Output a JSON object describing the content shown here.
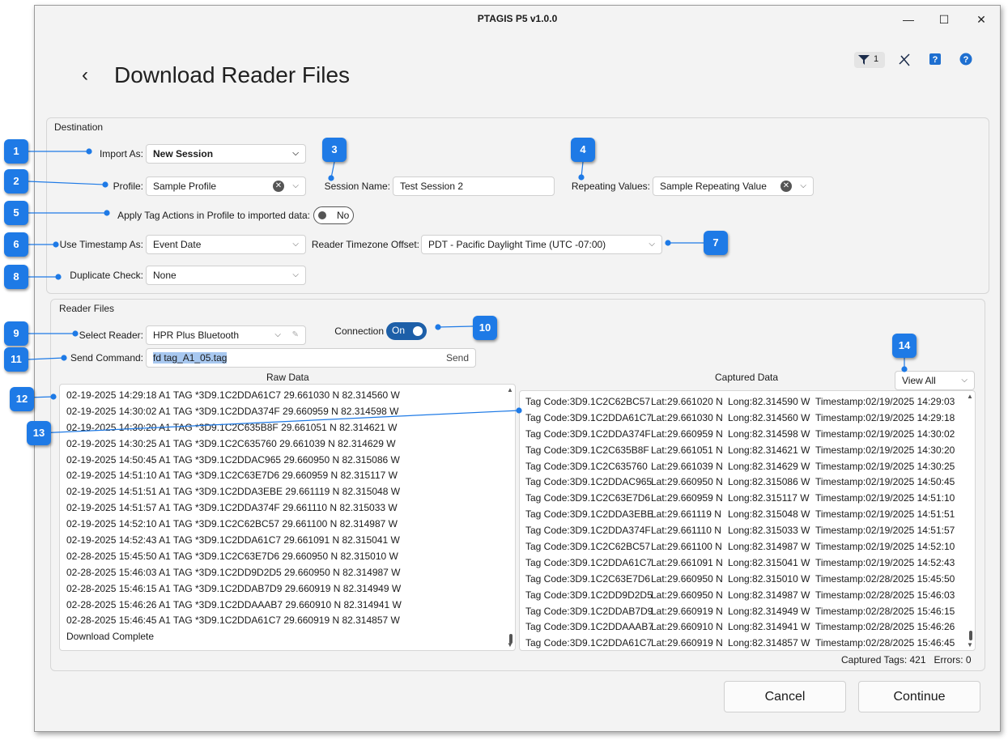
{
  "app_title": "PTAGIS P5 v1.0.0",
  "toolbar": {
    "filter_count": "1"
  },
  "page_title": "Download Reader Files",
  "destination": {
    "group_title": "Destination",
    "import_as_label": "Import As:",
    "import_as_value": "New Session",
    "profile_label": "Profile:",
    "profile_value": "Sample Profile",
    "session_name_label": "Session Name:",
    "session_name_value": "Test Session 2",
    "repeating_values_label": "Repeating Values:",
    "repeating_values_value": "Sample Repeating Value",
    "apply_tag_actions_label": "Apply Tag Actions in Profile to imported data:",
    "apply_tag_actions_value": "No",
    "timestamp_label": "Use Timestamp As:",
    "timestamp_value": "Event Date",
    "tz_label": "Reader Timezone Offset:",
    "tz_value": "PDT - Pacific Daylight Time (UTC -07:00)",
    "duplicate_label": "Duplicate Check:",
    "duplicate_value": "None"
  },
  "reader_files": {
    "group_title": "Reader Files",
    "select_reader_label": "Select Reader:",
    "select_reader_value": "HPR Plus Bluetooth",
    "connection_label": "Connection",
    "connection_value": "On",
    "send_command_label": "Send Command:",
    "send_command_value": "fd tag_A1_05.tag",
    "send_label": "Send",
    "raw_data_title": "Raw Data",
    "captured_data_title": "Captured Data",
    "view_value": "View All",
    "raw_data": [
      "02-19-2025 14:29:18 A1 TAG *3D9.1C2DDA61C7 29.661030 N 82.314560 W",
      "02-19-2025 14:30:02 A1 TAG *3D9.1C2DDA374F 29.660959 N 82.314598 W",
      "02-19-2025 14:30:20 A1 TAG *3D9.1C2C635B8F 29.661051 N 82.314621 W",
      "02-19-2025 14:30:25 A1 TAG *3D9.1C2C635760 29.661039 N 82.314629 W",
      "02-19-2025 14:50:45 A1 TAG *3D9.1C2DDAC965 29.660950 N 82.315086 W",
      "02-19-2025 14:51:10 A1 TAG *3D9.1C2C63E7D6 29.660959 N 82.315117 W",
      "02-19-2025 14:51:51 A1 TAG *3D9.1C2DDA3EBE 29.661119 N 82.315048 W",
      "02-19-2025 14:51:57 A1 TAG *3D9.1C2DDA374F 29.661110 N 82.315033 W",
      "02-19-2025 14:52:10 A1 TAG *3D9.1C2C62BC57 29.661100 N 82.314987 W",
      "02-19-2025 14:52:43 A1 TAG *3D9.1C2DDA61C7 29.661091 N 82.315041 W",
      "02-28-2025 15:45:50 A1 TAG *3D9.1C2C63E7D6 29.660950 N 82.315010 W",
      "02-28-2025 15:46:03 A1 TAG *3D9.1C2DD9D2D5 29.660950 N 82.314987 W",
      "02-28-2025 15:46:15 A1 TAG *3D9.1C2DDAB7D9 29.660919 N 82.314949 W",
      "02-28-2025 15:46:26 A1 TAG *3D9.1C2DDAAAB7 29.660910 N 82.314941 W",
      "02-28-2025 15:46:45 A1 TAG *3D9.1C2DDA61C7 29.660919 N 82.314857 W",
      "Download Complete"
    ],
    "captured_data": [
      [
        "Tag Code:3D9.1C2C62BC57",
        "Lat:29.661020 N",
        "Long:82.314590 W",
        "Timestamp:02/19/2025 14:29:03"
      ],
      [
        "Tag Code:3D9.1C2DDA61C7",
        "Lat:29.661030 N",
        "Long:82.314560 W",
        "Timestamp:02/19/2025 14:29:18"
      ],
      [
        "Tag Code:3D9.1C2DDA374F",
        "Lat:29.660959 N",
        "Long:82.314598 W",
        "Timestamp:02/19/2025 14:30:02"
      ],
      [
        "Tag Code:3D9.1C2C635B8F",
        "Lat:29.661051 N",
        "Long:82.314621 W",
        "Timestamp:02/19/2025 14:30:20"
      ],
      [
        "Tag Code:3D9.1C2C635760",
        "Lat:29.661039 N",
        "Long:82.314629 W",
        "Timestamp:02/19/2025 14:30:25"
      ],
      [
        "Tag Code:3D9.1C2DDAC965",
        "Lat:29.660950 N",
        "Long:82.315086 W",
        "Timestamp:02/19/2025 14:50:45"
      ],
      [
        "Tag Code:3D9.1C2C63E7D6",
        "Lat:29.660959 N",
        "Long:82.315117 W",
        "Timestamp:02/19/2025 14:51:10"
      ],
      [
        "Tag Code:3D9.1C2DDA3EBE",
        "Lat:29.661119 N",
        "Long:82.315048 W",
        "Timestamp:02/19/2025 14:51:51"
      ],
      [
        "Tag Code:3D9.1C2DDA374F",
        "Lat:29.661110 N",
        "Long:82.315033 W",
        "Timestamp:02/19/2025 14:51:57"
      ],
      [
        "Tag Code:3D9.1C2C62BC57",
        "Lat:29.661100 N",
        "Long:82.314987 W",
        "Timestamp:02/19/2025 14:52:10"
      ],
      [
        "Tag Code:3D9.1C2DDA61C7",
        "Lat:29.661091 N",
        "Long:82.315041 W",
        "Timestamp:02/19/2025 14:52:43"
      ],
      [
        "Tag Code:3D9.1C2C63E7D6",
        "Lat:29.660950 N",
        "Long:82.315010 W",
        "Timestamp:02/28/2025 15:45:50"
      ],
      [
        "Tag Code:3D9.1C2DD9D2D5",
        "Lat:29.660950 N",
        "Long:82.314987 W",
        "Timestamp:02/28/2025 15:46:03"
      ],
      [
        "Tag Code:3D9.1C2DDAB7D9",
        "Lat:29.660919 N",
        "Long:82.314949 W",
        "Timestamp:02/28/2025 15:46:15"
      ],
      [
        "Tag Code:3D9.1C2DDAAAB7",
        "Lat:29.660910 N",
        "Long:82.314941 W",
        "Timestamp:02/28/2025 15:46:26"
      ],
      [
        "Tag Code:3D9.1C2DDA61C7",
        "Lat:29.660919 N",
        "Long:82.314857 W",
        "Timestamp:02/28/2025 15:46:45"
      ]
    ],
    "captured_tags": "Captured Tags: 421",
    "errors": "Errors: 0"
  },
  "buttons": {
    "cancel": "Cancel",
    "continue": "Continue"
  },
  "callouts": [
    "1",
    "2",
    "3",
    "4",
    "5",
    "6",
    "7",
    "8",
    "9",
    "10",
    "11",
    "12",
    "13",
    "14"
  ],
  "colors": {
    "accent": "#1d5fa8",
    "callout": "#1e7ae6",
    "selection": "#a8c8f0"
  }
}
